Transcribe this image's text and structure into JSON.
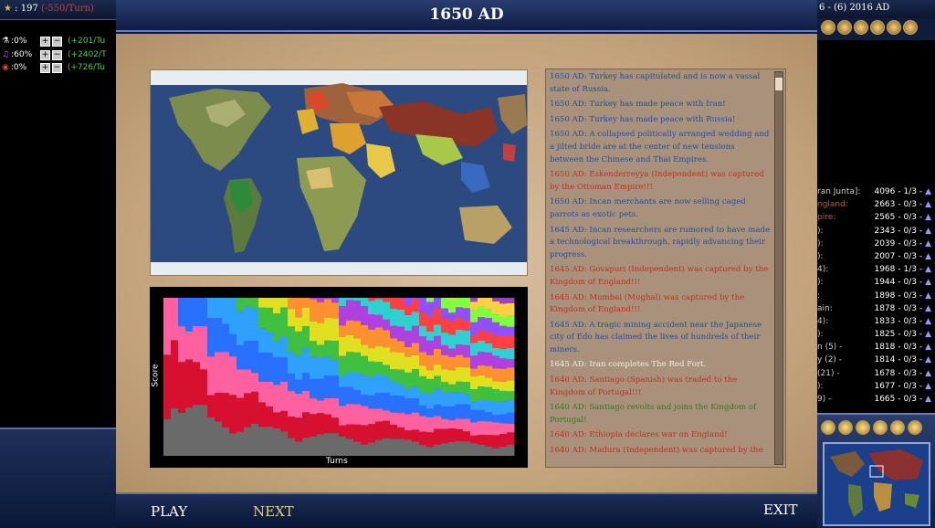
{
  "left_hud": {
    "gold": ": 197",
    "gold_rate": "(-550/Turn)",
    "sliders": [
      {
        "pct": ":0%",
        "income": "(+201/Tu",
        "icon": "science-icon"
      },
      {
        "pct": ":60%",
        "income": "(+2402/T",
        "icon": "culture-icon"
      },
      {
        "pct": ":0%",
        "income": "(+726/Tu",
        "icon": "espionage-icon"
      }
    ]
  },
  "right_hud": {
    "date_line": "6 - (6) 2016 AD",
    "scores": [
      {
        "civ": "ran Junta]:",
        "score": "4096",
        "wars": "- 1/3 -",
        "red": false
      },
      {
        "civ": "ngland:",
        "score": "2663",
        "wars": "- 0/3 -",
        "red": true
      },
      {
        "civ": "pire:",
        "score": "2565",
        "wars": "- 0/3 -",
        "red": true
      },
      {
        "civ": "):",
        "score": "2343",
        "wars": "- 0/3 -",
        "red": false
      },
      {
        "civ": "):",
        "score": "2039",
        "wars": "- 0/3 -",
        "red": false
      },
      {
        "civ": "):",
        "score": "2007",
        "wars": "- 0/3 -",
        "red": false
      },
      {
        "civ": "4):",
        "score": "1968",
        "wars": "- 1/3 -",
        "red": false
      },
      {
        "civ": "):",
        "score": "1944",
        "wars": "- 0/3 -",
        "red": false
      },
      {
        "civ": ":",
        "score": "1898",
        "wars": "- 0/3 -",
        "red": false
      },
      {
        "civ": "ain:",
        "score": "1878",
        "wars": "- 0/3 -",
        "red": false
      },
      {
        "civ": "4):",
        "score": "1833",
        "wars": "- 0/3 -",
        "red": false
      },
      {
        "civ": "):",
        "score": "1825",
        "wars": "- 0/3 -",
        "red": false
      },
      {
        "civ": "n (5) -",
        "score": "1818",
        "wars": "- 0/3 -",
        "red": false
      },
      {
        "civ": "y (2) -",
        "score": "1814",
        "wars": "- 0/3 -",
        "red": false
      },
      {
        "civ": "(21) -",
        "score": "1678",
        "wars": "- 0/3 -",
        "red": false
      },
      {
        "civ": "):",
        "score": "1677",
        "wars": "- 0/3 -",
        "red": false
      },
      {
        "civ": "9) -",
        "score": "1665",
        "wars": "- 0/3 -",
        "red": false
      }
    ]
  },
  "dialog": {
    "title": "1650 AD",
    "graph_xlabel": "Turns",
    "graph_ylabel": "Score",
    "buttons": {
      "play": "PLAY",
      "next": "NEXT",
      "exit": "EXIT"
    }
  },
  "events": [
    {
      "text": "1650 AD: Turkey has capitulated and is now a vassal state of Russia.",
      "color": "blue"
    },
    {
      "text": "1650 AD: Turkey has made peace with Iran!",
      "color": "blue"
    },
    {
      "text": "1650 AD: Turkey has made peace with Russia!",
      "color": "blue"
    },
    {
      "text": "1650 AD: A collapsed politically arranged wedding and a jilted bride are at the center of new tensions between the Chinese and Thai Empires.",
      "color": "blue"
    },
    {
      "text": "1650 AD: Eskenderreyya (Independent) was captured by the Ottoman Empire!!!",
      "color": "red"
    },
    {
      "text": "1650 AD: Incan merchants are now selling caged parrots as exotic pets.",
      "color": "blue"
    },
    {
      "text": "1645 AD: Incan researchers are rumored to have made a technological breakthrough, rapidly advancing their progress.",
      "color": "blue"
    },
    {
      "text": "1645 AD: Govapuri (Independent) was captured by the Kingdom of England!!!",
      "color": "red"
    },
    {
      "text": "1645 AD: Mumbai (Mughal) was captured by the Kingdom of England!!!",
      "color": "red"
    },
    {
      "text": "1645 AD: A tragic mining accident near the Japanese city of Edo has claimed the lives of hundreds of their miners.",
      "color": "blue"
    },
    {
      "text": "1645 AD: Iran completes The Red Fort.",
      "color": "white"
    },
    {
      "text": "1640 AD: Santiago (Spanish) was traded to the Kingdom of Portugal!!!",
      "color": "red"
    },
    {
      "text": "1640 AD: Santiago revolts and joins the Kingdom of Portugal!",
      "color": "green"
    },
    {
      "text": "1640 AD: Ethiopia declares war on England!",
      "color": "red"
    },
    {
      "text": "1640 AD: Madura (Independent) was captured by the",
      "color": "red"
    }
  ],
  "colors": {
    "parchment": "#c9ad8a",
    "hud_blue": "#1b2a4e",
    "event_blue": "#1e4f9c",
    "event_red": "#c0301e",
    "event_green": "#2e7a23"
  }
}
